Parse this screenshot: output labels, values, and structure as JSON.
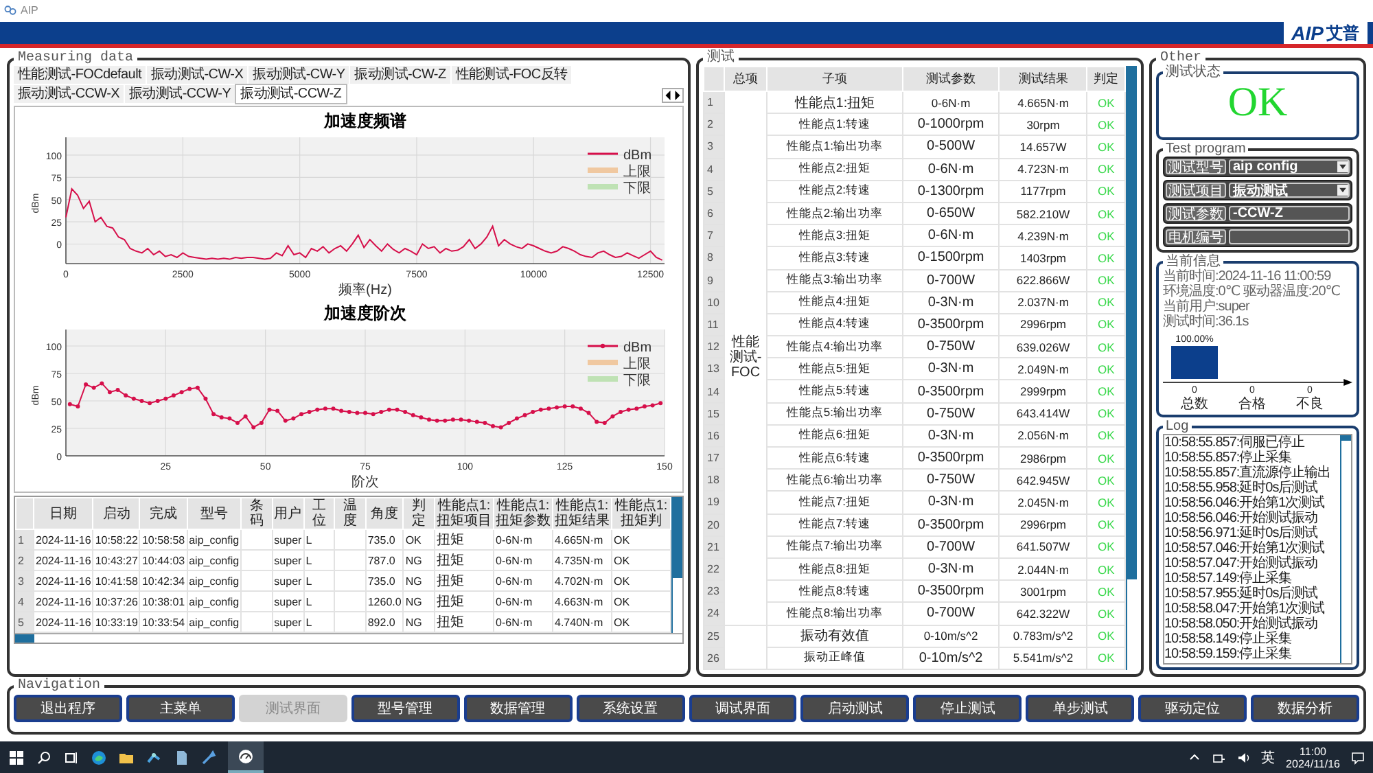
{
  "window": {
    "title": "AIP"
  },
  "banner": {
    "logo_latin": "AIP",
    "logo_cjk": "艾普"
  },
  "measuring": {
    "title": "Measuring data",
    "tabs": [
      {
        "label": "性能测试-FOCdefault",
        "selected": false
      },
      {
        "label": "振动测试-CW-X",
        "selected": false
      },
      {
        "label": "振动测试-CW-Y",
        "selected": false
      },
      {
        "label": "振动测试-CW-Z",
        "selected": false
      },
      {
        "label": "性能测试-FOC反转",
        "selected": false
      },
      {
        "label": "振动测试-CCW-X",
        "selected": false
      },
      {
        "label": "振动测试-CCW-Y",
        "selected": false
      },
      {
        "label": "振动测试-CCW-Z",
        "selected": true
      }
    ],
    "charts": [
      {
        "chart_data": {
          "type": "line",
          "title": "加速度频谱",
          "xlabel": "频率(Hz)",
          "ylabel": "dBm",
          "grid": true,
          "x": [
            0,
            125,
            250,
            375,
            500,
            625,
            750,
            875,
            1000,
            1125,
            1250,
            1375,
            1500,
            1625,
            1750,
            1875,
            2000,
            2125,
            2250,
            2375,
            2500,
            2625,
            2750,
            2875,
            3000,
            3125,
            3250,
            3375,
            3500,
            3625,
            3750,
            3875,
            4000,
            4125,
            4250,
            4375,
            4500,
            4625,
            4750,
            4875,
            5000,
            5125,
            5250,
            5375,
            5500,
            5625,
            5750,
            5875,
            6000,
            6125,
            6250,
            6375,
            6500,
            6625,
            6750,
            6875,
            7000,
            7125,
            7250,
            7375,
            7500,
            7625,
            7750,
            7875,
            8000,
            8125,
            8250,
            8375,
            8500,
            8625,
            8750,
            8875,
            9000,
            9125,
            9250,
            9375,
            9500,
            9625,
            9750,
            9875,
            10000,
            10125,
            10250,
            10375,
            10500,
            10625,
            10750,
            10875,
            11000,
            11125,
            11250,
            11375,
            11500,
            11625,
            11750,
            11875,
            12000,
            12125,
            12250,
            12375,
            12500,
            12625,
            12750
          ],
          "xlim": [
            0,
            12800
          ],
          "ylim": [
            -22,
            120
          ],
          "xticks": [
            0,
            2500,
            5000,
            7500,
            10000,
            12500
          ],
          "yticks": [
            0,
            25,
            50,
            75,
            100
          ],
          "series": [
            {
              "name": "dBm",
              "color": "#d60f4a",
              "values": [
                30,
                62,
                55,
                40,
                48,
                25,
                30,
                20,
                18,
                8,
                5,
                -5,
                -8,
                -10,
                -5,
                -12,
                -8,
                -14,
                -12,
                -15,
                -10,
                -14,
                -15,
                -16,
                -17,
                -16,
                -17,
                -16,
                -17,
                -15,
                -16,
                -15,
                -15,
                -16,
                -17,
                -16,
                -10,
                -13,
                -2,
                -12,
                -10,
                -15,
                -5,
                -8,
                -3,
                -10,
                -5,
                -2,
                -8,
                0,
                10,
                -4,
                5,
                -2,
                -8,
                0,
                -6,
                -10,
                -5,
                -8,
                -12,
                0,
                -5,
                -3,
                -10,
                -5,
                -8,
                -7,
                -3,
                5,
                -5,
                0,
                8,
                20,
                -2,
                5,
                0,
                -3,
                -5,
                0,
                -2,
                -5,
                -8,
                -10,
                -8,
                -3,
                -5,
                -8,
                -12,
                -14,
                -15,
                -10,
                -8,
                -12,
                -15,
                -14,
                -10,
                -13,
                -16,
                -12,
                -8,
                -15,
                -18
              ]
            }
          ]
        },
        "limit_legend": [
          {
            "name": "上限",
            "color": "#f0c8a0"
          },
          {
            "name": "下限",
            "color": "#bfe2b4"
          }
        ]
      },
      {
        "chart_data": {
          "type": "line",
          "title": "加速度阶次",
          "xlabel": "阶次",
          "ylabel": "dBm",
          "grid": true,
          "x": [
            1,
            3,
            5,
            7,
            9,
            11,
            13,
            15,
            17,
            19,
            21,
            23,
            25,
            27,
            29,
            31,
            33,
            35,
            37,
            39,
            41,
            43,
            45,
            47,
            49,
            51,
            53,
            55,
            57,
            59,
            61,
            63,
            65,
            67,
            69,
            71,
            73,
            75,
            77,
            79,
            81,
            83,
            85,
            87,
            89,
            91,
            93,
            95,
            97,
            99,
            101,
            103,
            105,
            107,
            109,
            111,
            113,
            115,
            117,
            119,
            121,
            123,
            125,
            127,
            129,
            131,
            133,
            135,
            137,
            139,
            141,
            143,
            145,
            147,
            149
          ],
          "xlim": [
            0,
            150
          ],
          "ylim": [
            0,
            115
          ],
          "xticks": [
            25,
            50,
            75,
            100,
            125,
            150
          ],
          "yticks": [
            0,
            25,
            50,
            75,
            100
          ],
          "series": [
            {
              "name": "dBm",
              "color": "#d60f4a",
              "marker": true,
              "values": [
                47,
                45,
                65,
                62,
                66,
                58,
                60,
                55,
                52,
                50,
                48,
                50,
                52,
                55,
                58,
                61,
                62,
                52,
                38,
                35,
                34,
                30,
                36,
                26,
                30,
                42,
                41,
                32,
                34,
                38,
                40,
                42,
                43,
                43,
                41,
                40,
                39,
                39,
                38,
                40,
                42,
                42,
                40,
                37,
                35,
                33,
                32,
                32,
                33,
                33,
                32,
                31,
                30,
                27,
                26,
                30,
                34,
                37,
                40,
                42,
                43,
                44,
                45,
                45,
                43,
                39,
                31,
                30,
                36,
                40,
                42,
                43,
                45,
                46,
                48
              ]
            }
          ]
        },
        "limit_legend": [
          {
            "name": "上限",
            "color": "#f0c8a0"
          },
          {
            "name": "下限",
            "color": "#bfe2b4"
          }
        ]
      }
    ],
    "table": {
      "columns": [
        "日期",
        "启动",
        "完成",
        "型号",
        "条码",
        "用户",
        "工位",
        "温度",
        "角度",
        "判定",
        "性能点1: 扭矩项目",
        "性能点1: 扭矩参数",
        "性能点1: 扭矩结果",
        "性能点1: 扭矩判"
      ],
      "rows": [
        {
          "no": "1",
          "cells": [
            "2024-11-16",
            "10:58:22",
            "10:58:58",
            "aip_config",
            null,
            "super",
            "L",
            null,
            "735.0",
            "OK",
            "扭矩",
            "0-6N·m",
            "4.665N·m",
            "OK"
          ]
        },
        {
          "no": "2",
          "cells": [
            "2024-11-16",
            "10:43:27",
            "10:44:03",
            "aip_config",
            null,
            "super",
            "L",
            null,
            "787.0",
            "NG",
            "扭矩",
            "0-6N·m",
            "4.735N·m",
            "OK"
          ]
        },
        {
          "no": "3",
          "cells": [
            "2024-11-16",
            "10:41:58",
            "10:42:34",
            "aip_config",
            null,
            "super",
            "L",
            null,
            "735.0",
            "NG",
            "扭矩",
            "0-6N·m",
            "4.702N·m",
            "OK"
          ]
        },
        {
          "no": "4",
          "cells": [
            "2024-11-16",
            "10:37:26",
            "10:38:01",
            "aip_config",
            null,
            "super",
            "L",
            null,
            "1260.0",
            "NG",
            "扭矩",
            "0-6N·m",
            "4.663N·m",
            "OK"
          ]
        },
        {
          "no": "5",
          "cells": [
            "2024-11-16",
            "10:33:19",
            "10:33:54",
            "aip_config",
            null,
            "super",
            "L",
            null,
            "892.0",
            "NG",
            "扭矩",
            "0-6N·m",
            "4.740N·m",
            "OK"
          ]
        }
      ]
    }
  },
  "test": {
    "title": "测试",
    "columns": [
      "总项",
      "子项",
      "测试参数",
      "测试结果",
      "判定"
    ],
    "groups": [
      {
        "name": "性能测试-FOC",
        "rows": [
          {
            "no": "1",
            "item": "性能点1:扭矩",
            "param": "0-6N·m",
            "result": "4.665N·m",
            "verdict": "OK"
          },
          {
            "no": "2",
            "item": "性能点1:转速",
            "param": "0-1000rpm",
            "result": "30rpm",
            "verdict": "OK"
          },
          {
            "no": "3",
            "item": "性能点1:输出功率",
            "param": "0-500W",
            "result": "14.657W",
            "verdict": "OK"
          },
          {
            "no": "4",
            "item": "性能点2:扭矩",
            "param": "0-6N·m",
            "result": "4.723N·m",
            "verdict": "OK"
          },
          {
            "no": "5",
            "item": "性能点2:转速",
            "param": "0-1300rpm",
            "result": "1177rpm",
            "verdict": "OK"
          },
          {
            "no": "6",
            "item": "性能点2:输出功率",
            "param": "0-650W",
            "result": "582.210W",
            "verdict": "OK"
          },
          {
            "no": "7",
            "item": "性能点3:扭矩",
            "param": "0-6N·m",
            "result": "4.239N·m",
            "verdict": "OK"
          },
          {
            "no": "8",
            "item": "性能点3:转速",
            "param": "0-1500rpm",
            "result": "1403rpm",
            "verdict": "OK"
          },
          {
            "no": "9",
            "item": "性能点3:输出功率",
            "param": "0-700W",
            "result": "622.866W",
            "verdict": "OK"
          },
          {
            "no": "10",
            "item": "性能点4:扭矩",
            "param": "0-3N·m",
            "result": "2.037N·m",
            "verdict": "OK"
          },
          {
            "no": "11",
            "item": "性能点4:转速",
            "param": "0-3500rpm",
            "result": "2996rpm",
            "verdict": "OK"
          },
          {
            "no": "12",
            "item": "性能点4:输出功率",
            "param": "0-750W",
            "result": "639.026W",
            "verdict": "OK"
          },
          {
            "no": "13",
            "item": "性能点5:扭矩",
            "param": "0-3N·m",
            "result": "2.049N·m",
            "verdict": "OK"
          },
          {
            "no": "14",
            "item": "性能点5:转速",
            "param": "0-3500rpm",
            "result": "2999rpm",
            "verdict": "OK"
          },
          {
            "no": "15",
            "item": "性能点5:输出功率",
            "param": "0-750W",
            "result": "643.414W",
            "verdict": "OK"
          },
          {
            "no": "16",
            "item": "性能点6:扭矩",
            "param": "0-3N·m",
            "result": "2.056N·m",
            "verdict": "OK"
          },
          {
            "no": "17",
            "item": "性能点6:转速",
            "param": "0-3500rpm",
            "result": "2986rpm",
            "verdict": "OK"
          },
          {
            "no": "18",
            "item": "性能点6:输出功率",
            "param": "0-750W",
            "result": "642.945W",
            "verdict": "OK"
          },
          {
            "no": "19",
            "item": "性能点7:扭矩",
            "param": "0-3N·m",
            "result": "2.045N·m",
            "verdict": "OK"
          },
          {
            "no": "20",
            "item": "性能点7:转速",
            "param": "0-3500rpm",
            "result": "2996rpm",
            "verdict": "OK"
          },
          {
            "no": "21",
            "item": "性能点7:输出功率",
            "param": "0-700W",
            "result": "641.507W",
            "verdict": "OK"
          },
          {
            "no": "22",
            "item": "性能点8:扭矩",
            "param": "0-3N·m",
            "result": "2.044N·m",
            "verdict": "OK"
          },
          {
            "no": "23",
            "item": "性能点8:转速",
            "param": "0-3500rpm",
            "result": "3001rpm",
            "verdict": "OK"
          },
          {
            "no": "24",
            "item": "性能点8:输出功率",
            "param": "0-700W",
            "result": "642.322W",
            "verdict": "OK"
          }
        ]
      },
      {
        "rows": [
          {
            "no": "25",
            "item": "振动有效值",
            "param": "0-10m/s^2",
            "result": "0.783m/s^2",
            "verdict": "OK"
          },
          {
            "no": "26",
            "item": "振动正峰值",
            "param": "0-10m/s^2",
            "result": "5.541m/s^2",
            "verdict": "OK"
          }
        ]
      }
    ]
  },
  "other": {
    "title": "Other",
    "status": {
      "title": "测试状态",
      "result": "OK"
    },
    "program": {
      "title": "Test program",
      "fields": [
        {
          "kind": "dropdown",
          "label": "测试型号",
          "value": "aip config"
        },
        {
          "kind": "dropdown",
          "label": "测试项目",
          "value": "振动测试"
        },
        {
          "kind": "text",
          "label": "测试参数",
          "value": "-CCW-Z"
        },
        {
          "kind": "text",
          "label": "电机编号"
        }
      ]
    },
    "info": {
      "title": "当前信息",
      "lines": [
        "当前时间:2024-11-16 11:00:59",
        "环境温度:0℃ 驱动器温度:20℃",
        "当前用户:super",
        "测试时间:36.1s"
      ],
      "stats": [
        {
          "percent": "100.00%",
          "count": "0",
          "label": "总数"
        },
        {
          "count": "0",
          "label": "合格"
        },
        {
          "count": "0",
          "label": "不良"
        }
      ]
    },
    "log": {
      "title": "Log",
      "lines": [
        "10:58:55.857:伺服已停止",
        "10:58:55.857:停止采集",
        "10:58:55.857:直流源停止输出",
        "10:58:55.958:延时0s后测试",
        "10:58:56.046:开始第1次测试",
        "10:58:56.046:开始测试振动",
        "10:58:56.971:延时0s后测试",
        "10:58:57.046:开始第1次测试",
        "10:58:57.047:开始测试振动",
        "10:58:57.149:停止采集",
        "10:58:57.955:延时0s后测试",
        "10:58:58.047:开始第1次测试",
        "10:58:58.050:开始测试振动",
        "10:58:58.149:停止采集",
        "10:58:59.159:停止采集"
      ]
    }
  },
  "navigation": {
    "title": "Navigation",
    "buttons": [
      {
        "label": "退出程序",
        "disabled": false
      },
      {
        "label": "主菜单",
        "disabled": false
      },
      {
        "label": "测试界面",
        "disabled": true
      },
      {
        "label": "型号管理",
        "disabled": false
      },
      {
        "label": "数据管理",
        "disabled": false
      },
      {
        "label": "系统设置",
        "disabled": false
      },
      {
        "label": "调试界面",
        "disabled": false
      },
      {
        "label": "启动测试",
        "disabled": false
      },
      {
        "label": "停止测试",
        "disabled": false
      },
      {
        "label": "单步测试",
        "disabled": false
      },
      {
        "label": "驱动定位",
        "disabled": false
      },
      {
        "label": "数据分析",
        "disabled": false
      }
    ]
  },
  "taskbar": {
    "ime": "英",
    "time": "11:00",
    "date": "2024/11/16"
  }
}
